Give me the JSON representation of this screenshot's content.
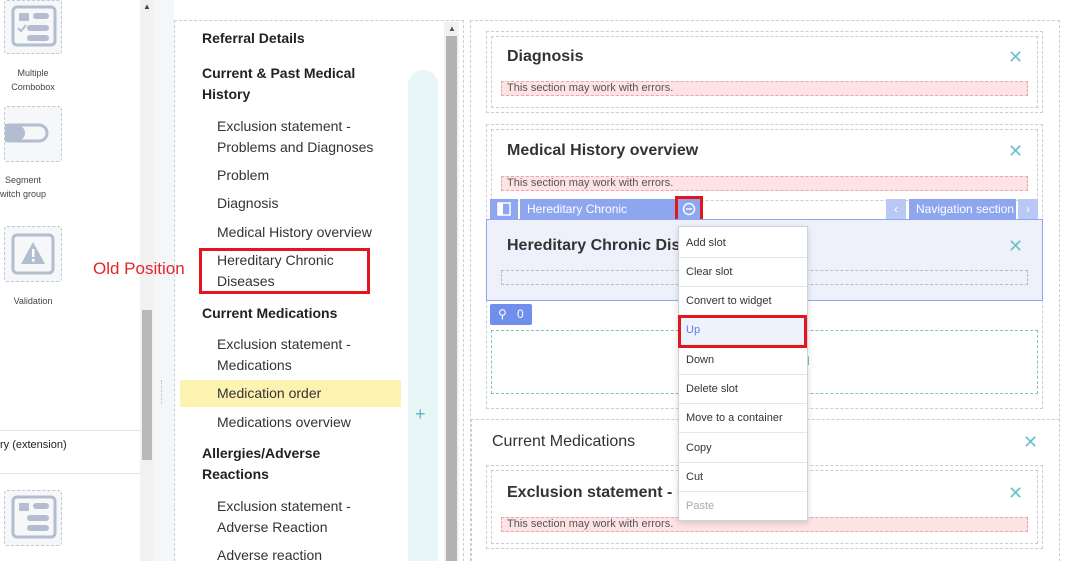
{
  "palette": {
    "tiles": [
      {
        "label_line1": "Multiple",
        "label_line2": "Combobox",
        "icon": "form-list-icon"
      },
      {
        "label_line1": "Segment",
        "label_line2": "witch group",
        "icon": "toggle-icon"
      },
      {
        "label_line1": "Validation",
        "label_line2": "",
        "icon": "warning-icon"
      },
      {
        "label_line1": "",
        "label_line2": "",
        "icon": "form-list-icon"
      }
    ],
    "extension_label": "ry (extension)"
  },
  "annotation": {
    "old_position_label": "Old Position",
    "color": "#e2161d"
  },
  "nav": {
    "items": [
      {
        "text": "Referral Details",
        "kind": "section"
      },
      {
        "text": "Current & Past Medical",
        "kind": "section"
      },
      {
        "text": "History",
        "kind": "section"
      },
      {
        "text": "Exclusion statement -",
        "kind": "item"
      },
      {
        "text": "Problems and Diagnoses",
        "kind": "item"
      },
      {
        "text": "Problem",
        "kind": "item"
      },
      {
        "text": "Diagnosis",
        "kind": "item"
      },
      {
        "text": "Medical History overview",
        "kind": "item"
      },
      {
        "text": "Hereditary Chronic",
        "kind": "item"
      },
      {
        "text": "Diseases",
        "kind": "item"
      },
      {
        "text": "Current Medications",
        "kind": "section"
      },
      {
        "text": "Exclusion statement -",
        "kind": "item"
      },
      {
        "text": "Medications",
        "kind": "item"
      },
      {
        "text": "Medication order",
        "kind": "item-active"
      },
      {
        "text": "Medications overview",
        "kind": "item"
      },
      {
        "text": "Allergies/Adverse",
        "kind": "section"
      },
      {
        "text": "Reactions",
        "kind": "section"
      },
      {
        "text": "Exclusion statement -",
        "kind": "item"
      },
      {
        "text": "Adverse Reaction",
        "kind": "item"
      },
      {
        "text": "Adverse reaction",
        "kind": "item"
      }
    ],
    "add_symbol": "+",
    "active_color": "#fdf3b0"
  },
  "canvas": {
    "diagnosis_title": "Diagnosis",
    "medical_history_title": "Medical History overview",
    "hereditary_title": "Hereditary Chronic Dise",
    "current_medications_title": "Current Medications",
    "exclusion_title": "Exclusion statement - M",
    "error_text": "This section may work with errors.",
    "close_symbol": "✕",
    "link_count": "0",
    "drop_zone_partial": "n"
  },
  "toolbar": {
    "slot_name": "Hereditary Chronic Diseases",
    "navigation_label": "Navigation section",
    "prev_symbol": "‹",
    "next_symbol": "›"
  },
  "menu": {
    "items": [
      {
        "label": "Add slot",
        "state": "normal"
      },
      {
        "label": "Clear slot",
        "state": "normal"
      },
      {
        "label": "Convert to widget",
        "state": "normal"
      },
      {
        "label": "Up",
        "state": "highlighted"
      },
      {
        "label": "Down",
        "state": "normal"
      },
      {
        "label": "Delete slot",
        "state": "normal"
      },
      {
        "label": "Move to a container",
        "state": "normal"
      },
      {
        "label": "Copy",
        "state": "normal"
      },
      {
        "label": "Cut",
        "state": "normal"
      },
      {
        "label": "Paste",
        "state": "disabled"
      }
    ]
  },
  "colors": {
    "accent": "#8ea6f0",
    "teal": "#6cc3c8",
    "error_bg": "#fde3e3"
  }
}
